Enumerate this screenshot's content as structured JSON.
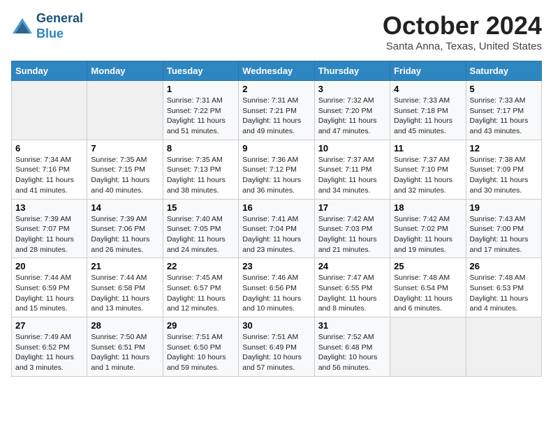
{
  "header": {
    "logo_line1": "General",
    "logo_line2": "Blue",
    "month": "October 2024",
    "location": "Santa Anna, Texas, United States"
  },
  "weekdays": [
    "Sunday",
    "Monday",
    "Tuesday",
    "Wednesday",
    "Thursday",
    "Friday",
    "Saturday"
  ],
  "weeks": [
    [
      null,
      null,
      {
        "day": 1,
        "sunrise": "7:31 AM",
        "sunset": "7:22 PM",
        "daylight": "11 hours and 51 minutes."
      },
      {
        "day": 2,
        "sunrise": "7:31 AM",
        "sunset": "7:21 PM",
        "daylight": "11 hours and 49 minutes."
      },
      {
        "day": 3,
        "sunrise": "7:32 AM",
        "sunset": "7:20 PM",
        "daylight": "11 hours and 47 minutes."
      },
      {
        "day": 4,
        "sunrise": "7:33 AM",
        "sunset": "7:18 PM",
        "daylight": "11 hours and 45 minutes."
      },
      {
        "day": 5,
        "sunrise": "7:33 AM",
        "sunset": "7:17 PM",
        "daylight": "11 hours and 43 minutes."
      }
    ],
    [
      {
        "day": 6,
        "sunrise": "7:34 AM",
        "sunset": "7:16 PM",
        "daylight": "11 hours and 41 minutes."
      },
      {
        "day": 7,
        "sunrise": "7:35 AM",
        "sunset": "7:15 PM",
        "daylight": "11 hours and 40 minutes."
      },
      {
        "day": 8,
        "sunrise": "7:35 AM",
        "sunset": "7:13 PM",
        "daylight": "11 hours and 38 minutes."
      },
      {
        "day": 9,
        "sunrise": "7:36 AM",
        "sunset": "7:12 PM",
        "daylight": "11 hours and 36 minutes."
      },
      {
        "day": 10,
        "sunrise": "7:37 AM",
        "sunset": "7:11 PM",
        "daylight": "11 hours and 34 minutes."
      },
      {
        "day": 11,
        "sunrise": "7:37 AM",
        "sunset": "7:10 PM",
        "daylight": "11 hours and 32 minutes."
      },
      {
        "day": 12,
        "sunrise": "7:38 AM",
        "sunset": "7:09 PM",
        "daylight": "11 hours and 30 minutes."
      }
    ],
    [
      {
        "day": 13,
        "sunrise": "7:39 AM",
        "sunset": "7:07 PM",
        "daylight": "11 hours and 28 minutes."
      },
      {
        "day": 14,
        "sunrise": "7:39 AM",
        "sunset": "7:06 PM",
        "daylight": "11 hours and 26 minutes."
      },
      {
        "day": 15,
        "sunrise": "7:40 AM",
        "sunset": "7:05 PM",
        "daylight": "11 hours and 24 minutes."
      },
      {
        "day": 16,
        "sunrise": "7:41 AM",
        "sunset": "7:04 PM",
        "daylight": "11 hours and 23 minutes."
      },
      {
        "day": 17,
        "sunrise": "7:42 AM",
        "sunset": "7:03 PM",
        "daylight": "11 hours and 21 minutes."
      },
      {
        "day": 18,
        "sunrise": "7:42 AM",
        "sunset": "7:02 PM",
        "daylight": "11 hours and 19 minutes."
      },
      {
        "day": 19,
        "sunrise": "7:43 AM",
        "sunset": "7:00 PM",
        "daylight": "11 hours and 17 minutes."
      }
    ],
    [
      {
        "day": 20,
        "sunrise": "7:44 AM",
        "sunset": "6:59 PM",
        "daylight": "11 hours and 15 minutes."
      },
      {
        "day": 21,
        "sunrise": "7:44 AM",
        "sunset": "6:58 PM",
        "daylight": "11 hours and 13 minutes."
      },
      {
        "day": 22,
        "sunrise": "7:45 AM",
        "sunset": "6:57 PM",
        "daylight": "11 hours and 12 minutes."
      },
      {
        "day": 23,
        "sunrise": "7:46 AM",
        "sunset": "6:56 PM",
        "daylight": "11 hours and 10 minutes."
      },
      {
        "day": 24,
        "sunrise": "7:47 AM",
        "sunset": "6:55 PM",
        "daylight": "11 hours and 8 minutes."
      },
      {
        "day": 25,
        "sunrise": "7:48 AM",
        "sunset": "6:54 PM",
        "daylight": "11 hours and 6 minutes."
      },
      {
        "day": 26,
        "sunrise": "7:48 AM",
        "sunset": "6:53 PM",
        "daylight": "11 hours and 4 minutes."
      }
    ],
    [
      {
        "day": 27,
        "sunrise": "7:49 AM",
        "sunset": "6:52 PM",
        "daylight": "11 hours and 3 minutes."
      },
      {
        "day": 28,
        "sunrise": "7:50 AM",
        "sunset": "6:51 PM",
        "daylight": "11 hours and 1 minute."
      },
      {
        "day": 29,
        "sunrise": "7:51 AM",
        "sunset": "6:50 PM",
        "daylight": "10 hours and 59 minutes."
      },
      {
        "day": 30,
        "sunrise": "7:51 AM",
        "sunset": "6:49 PM",
        "daylight": "10 hours and 57 minutes."
      },
      {
        "day": 31,
        "sunrise": "7:52 AM",
        "sunset": "6:48 PM",
        "daylight": "10 hours and 56 minutes."
      },
      null,
      null
    ]
  ]
}
